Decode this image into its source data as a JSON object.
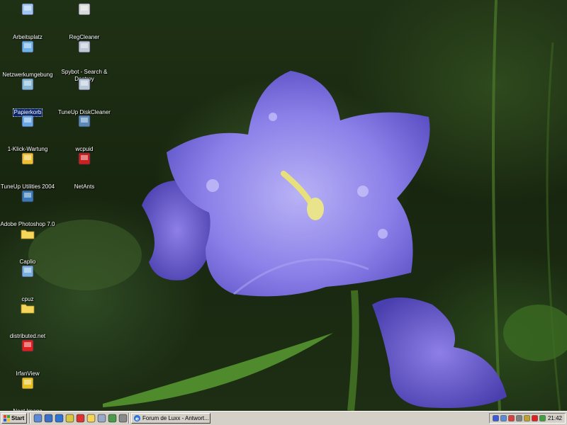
{
  "desktop": {
    "icons_left": [
      {
        "label": "Arbeitsplatz",
        "icon": "my-computer-icon"
      },
      {
        "label": "Netzwerkumgebung",
        "icon": "network-icon"
      },
      {
        "label": "Papierkorb",
        "icon": "recycle-bin-icon",
        "selected": true
      },
      {
        "label": "1-Klick-Wartung",
        "icon": "maintenance-icon"
      },
      {
        "label": "TuneUp Utilities 2004",
        "icon": "tuneup-icon"
      },
      {
        "label": "Adobe Photoshop 7.0",
        "icon": "photoshop-icon"
      },
      {
        "label": "Caplio",
        "icon": "folder-icon"
      },
      {
        "label": "cpuz",
        "icon": "cpuz-icon"
      },
      {
        "label": "distributed.net",
        "icon": "folder-icon"
      },
      {
        "label": "IrfanView",
        "icon": "irfanview-icon"
      },
      {
        "label": "Neat Image",
        "icon": "neat-image-icon"
      }
    ],
    "icons_right": [
      {
        "label": "RegCleaner",
        "icon": "regcleaner-icon"
      },
      {
        "label": "Spybot - Search &\nDestroy",
        "icon": "spybot-icon"
      },
      {
        "label": "TuneUp DiskCleaner",
        "icon": "diskcleaner-icon"
      },
      {
        "label": "wcpuid",
        "icon": "wcpuid-icon"
      },
      {
        "label": "NetAnts",
        "icon": "netants-icon"
      }
    ]
  },
  "taskbar": {
    "start_label": "Start",
    "quick_launch": [
      "desktop-icon",
      "outlook-icon",
      "ie-icon",
      "chat-icon",
      "opera-icon",
      "folder-icon",
      "notepad-icon",
      "media-icon",
      "settings-icon"
    ],
    "tasks": [
      {
        "label": "Forum de Luxx - Antwort...",
        "icon": "ie-icon"
      }
    ],
    "tray_icons": [
      "monitor-icon",
      "network-icon",
      "antivirus-icon",
      "volume-icon",
      "firewall-icon",
      "close-icon",
      "messenger-icon"
    ],
    "clock": "21:42"
  }
}
